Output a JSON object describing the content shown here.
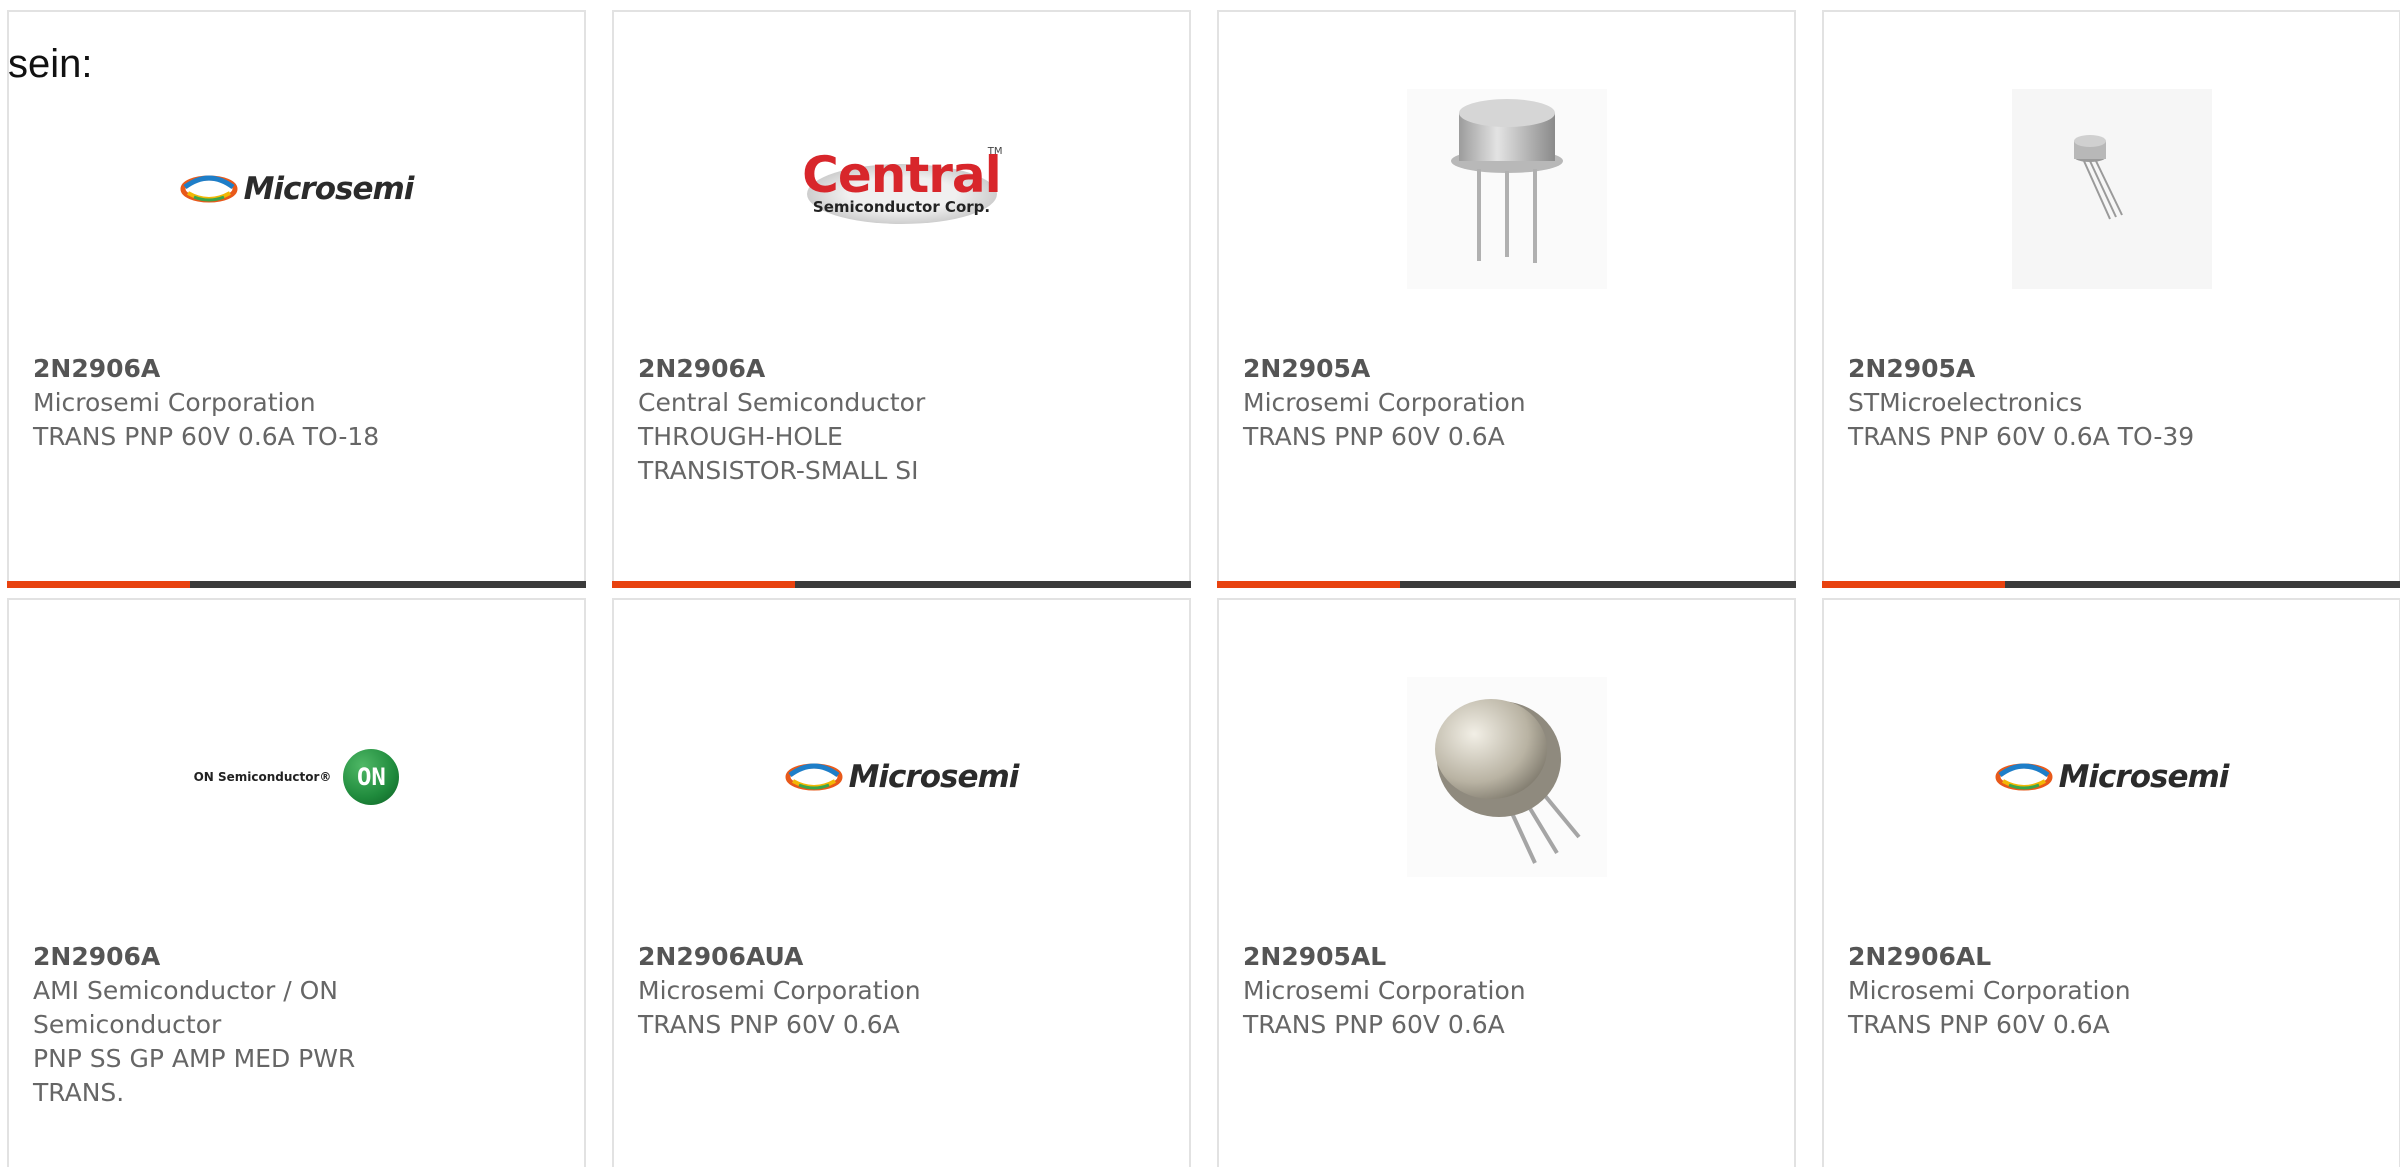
{
  "intro_text": "sein:",
  "colors": {
    "accent": "#e8420f",
    "bar": "#3b3b3b",
    "border": "#e2e2e2",
    "text": "#666666"
  },
  "products": [
    {
      "part_number": "2N2906A",
      "manufacturer": "Microsemi Corporation",
      "description": "TRANS PNP 60V 0.6A TO-18",
      "image": "microsemi-logo"
    },
    {
      "part_number": "2N2906A",
      "manufacturer": "Central Semiconductor",
      "description": "THROUGH-HOLE TRANSISTOR-SMALL SI",
      "image": "central-semiconductor-logo"
    },
    {
      "part_number": "2N2905A",
      "manufacturer": "Microsemi Corporation",
      "description": "TRANS PNP 60V 0.6A",
      "image": "to39-transistor-photo"
    },
    {
      "part_number": "2N2905A",
      "manufacturer": "STMicroelectronics",
      "description": "TRANS PNP 60V 0.6A TO-39",
      "image": "small-transistor-photo"
    },
    {
      "part_number": "2N2906A",
      "manufacturer": "AMI Semiconductor / ON Semiconductor",
      "description": "PNP SS GP AMP MED PWR TRANS.",
      "image": "on-semiconductor-logo"
    },
    {
      "part_number": "2N2906AUA",
      "manufacturer": "Microsemi Corporation",
      "description": "TRANS PNP 60V 0.6A",
      "image": "microsemi-logo"
    },
    {
      "part_number": "2N2905AL",
      "manufacturer": "Microsemi Corporation",
      "description": "TRANS PNP 60V 0.6A",
      "image": "metal-can-transistor-photo"
    },
    {
      "part_number": "2N2906AL",
      "manufacturer": "Microsemi Corporation",
      "description": "TRANS PNP 60V 0.6A",
      "image": "microsemi-logo"
    }
  ],
  "logos": {
    "microsemi": "Microsemi",
    "central": "Central",
    "central_sub": "Semiconductor Corp.",
    "central_tm": "TM",
    "on_text": "ON Semiconductor®",
    "on_badge": "ON"
  }
}
